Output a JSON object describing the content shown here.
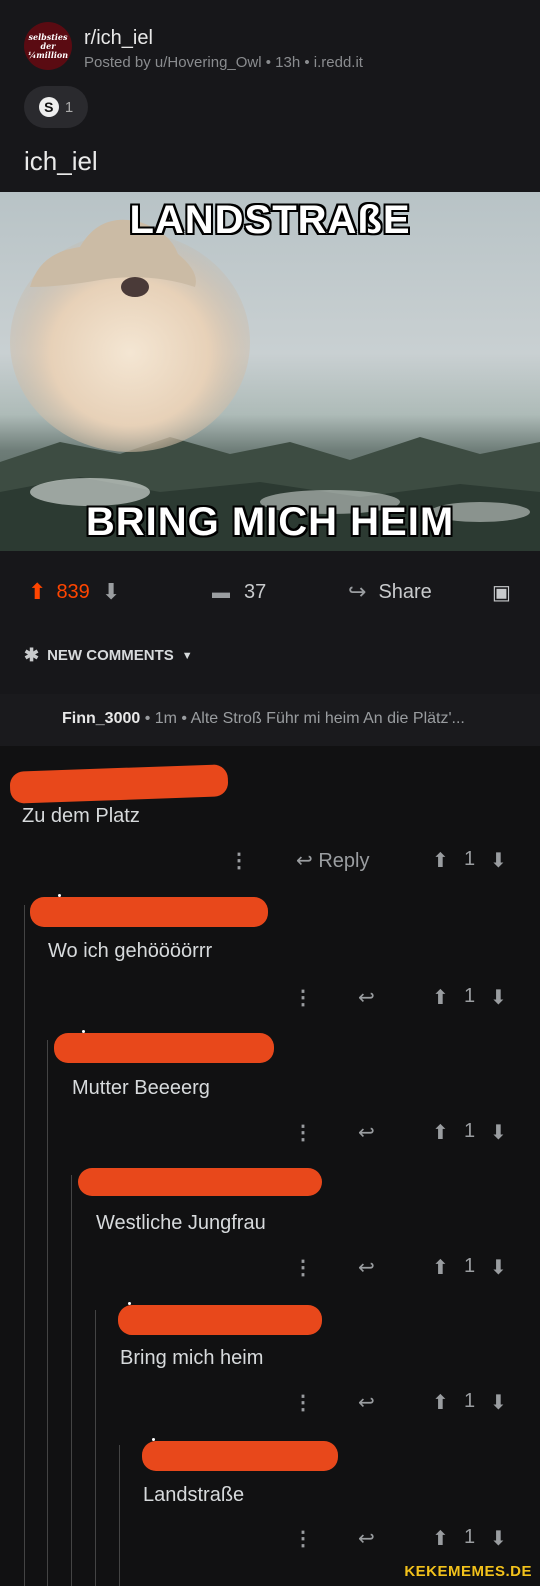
{
  "post": {
    "avatar_lines": [
      "selbsties",
      "der",
      "¼million"
    ],
    "subreddit": "r/ich_iel",
    "meta": "Posted by u/Hovering_Owl • 13h • i.redd.it",
    "award_count": "1",
    "title": "ich_iel",
    "meme_top": "LANDSTRAßE",
    "meme_bottom": "BRING MICH HEIM",
    "votes": "839",
    "comments": "37",
    "share": "Share",
    "new_comments": "NEW COMMENTS"
  },
  "pinned": {
    "user": "Finn_3000",
    "text": " • 1m • Alte Stroß Führ mi heim An die Plätz'..."
  },
  "comments": [
    {
      "text": "Zu dem Platz",
      "reply": "Reply",
      "score": "1"
    },
    {
      "text": "Wo ich gehöööörrr",
      "score": "1"
    },
    {
      "text": "Mutter Beeeerg",
      "score": "1"
    },
    {
      "text": "Westliche Jungfrau",
      "score": "1"
    },
    {
      "text": "Bring mich heim",
      "score": "1"
    },
    {
      "text": "Landstraße",
      "score": "1"
    }
  ],
  "watermark": "KEKEMEMES.DE",
  "colors": {
    "accent": "#ff4500",
    "scribble": "#e8481b",
    "background": "#111112"
  }
}
